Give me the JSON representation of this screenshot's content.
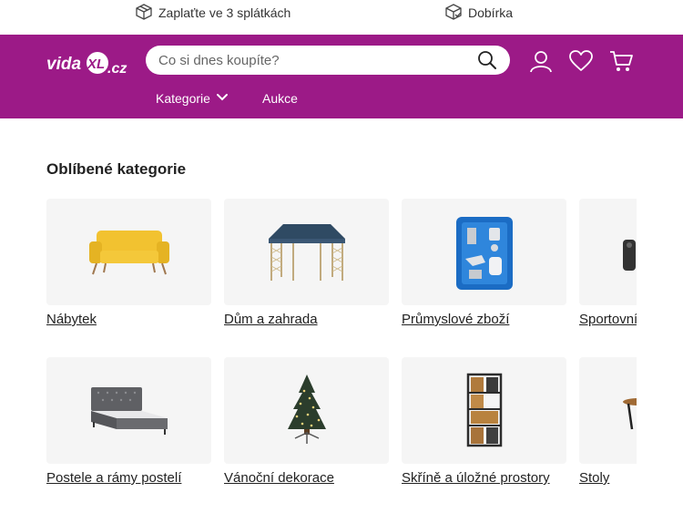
{
  "promo": {
    "item1": "Zaplaťte ve 3 splátkách",
    "item2": "Dobírka"
  },
  "header": {
    "logo_text": "vidaXL.cz",
    "search_placeholder": "Co si dnes koupíte?",
    "nav": [
      "Kategorie",
      "Aukce"
    ]
  },
  "main": {
    "section_title": "Oblíbené kategorie",
    "categories": [
      {
        "label": "Nábytek",
        "icon": "sofa-icon"
      },
      {
        "label": "Dům a zahrada",
        "icon": "gazebo-icon"
      },
      {
        "label": "Průmyslové zboží",
        "icon": "spray-gun-kit-icon"
      },
      {
        "label": "Sportovní",
        "icon": "sport-item-icon"
      },
      {
        "label": "Postele a rámy postelí",
        "icon": "bed-icon"
      },
      {
        "label": "Vánoční dekorace",
        "icon": "christmas-tree-icon"
      },
      {
        "label": "Skříně a úložné prostory",
        "icon": "shelf-icon"
      },
      {
        "label": "Stoly",
        "icon": "table-icon"
      }
    ]
  },
  "colors": {
    "brand": "#9c1a87",
    "tile_bg": "#f5f5f5"
  }
}
